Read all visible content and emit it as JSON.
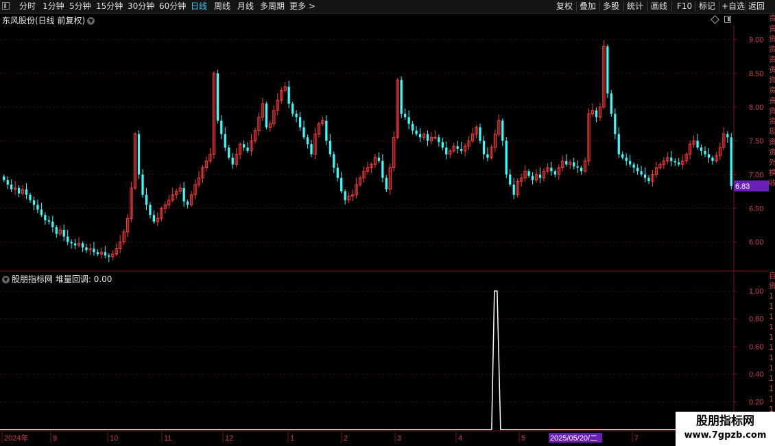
{
  "toolbar": {
    "left_items": [
      "分时",
      "1分钟",
      "5分钟",
      "15分钟",
      "30分钟",
      "60分钟",
      "日线",
      "周线",
      "月线",
      "多周期",
      "更多 >"
    ],
    "active_item": "日线",
    "right_items": [
      "复权",
      "叠加",
      "多股",
      "统计",
      "画线",
      "F10",
      "标记",
      "+自选",
      "返回"
    ]
  },
  "main_chart": {
    "title": "东风股份(日线 前复权)",
    "current_price_label": "6.83",
    "price_label_color": "#6a1fb8"
  },
  "indicator": {
    "title": "股朋指标网",
    "line_label": "堆量回调: 0.00"
  },
  "date_axis": {
    "labels": [
      "2024年",
      "9",
      "10",
      "11",
      "12",
      "1",
      "2",
      "3",
      "4",
      "5"
    ],
    "labels_after": [
      "7"
    ],
    "highlight_date": "2025/05/20/二"
  },
  "right_strip_chars": [
    "资",
    "资",
    "资",
    "资",
    "资",
    "资",
    "资",
    "资",
    "资",
    "资",
    "资",
    "现",
    "资",
    "资",
    "外",
    "换",
    "收",
    "",
    "",
    "",
    "",
    "",
    "",
    "",
    "",
    "自",
    "资",
    "1",
    "1",
    "1",
    "1",
    "1",
    "1",
    "1",
    "1",
    "1",
    "1",
    "1",
    "1"
  ],
  "watermark": {
    "name": "股朋指标网",
    "url": "www.7gpzb.com"
  },
  "colors": {
    "up": "#ff3b3b",
    "down": "#33ffff",
    "grid": "#4a0c0c",
    "axis_text": "#c94040",
    "indicator_line": "#ffffff"
  },
  "chart_data": [
    {
      "type": "candlestick",
      "title": "东风股份(日线 前复权)",
      "y_ticks": [
        6.0,
        6.5,
        7.0,
        7.5,
        8.0,
        8.5,
        9.0
      ],
      "ylim": [
        5.6,
        9.2
      ],
      "last_close": 6.83,
      "n_bars": 180,
      "closes": [
        6.92,
        6.85,
        6.78,
        6.8,
        6.72,
        6.78,
        6.7,
        6.62,
        6.55,
        6.48,
        6.4,
        6.32,
        6.3,
        6.22,
        6.12,
        6.18,
        6.08,
        6.0,
        5.98,
        5.95,
        5.98,
        5.92,
        5.88,
        5.9,
        5.85,
        5.82,
        5.85,
        5.8,
        5.78,
        5.82,
        5.9,
        6.0,
        6.15,
        6.35,
        6.8,
        7.6,
        7.0,
        6.7,
        6.55,
        6.4,
        6.3,
        6.35,
        6.5,
        6.55,
        6.62,
        6.7,
        6.75,
        6.8,
        6.6,
        6.55,
        6.7,
        6.85,
        6.95,
        7.1,
        7.2,
        7.3,
        8.5,
        7.8,
        7.6,
        7.4,
        7.25,
        7.15,
        7.3,
        7.45,
        7.4,
        7.35,
        7.5,
        7.65,
        7.85,
        8.05,
        7.7,
        7.75,
        7.95,
        8.1,
        8.25,
        8.3,
        8.05,
        7.9,
        7.85,
        7.7,
        7.55,
        7.45,
        7.3,
        7.6,
        7.75,
        7.8,
        7.5,
        7.3,
        7.1,
        6.95,
        6.75,
        6.62,
        6.68,
        6.7,
        6.85,
        6.95,
        7.05,
        7.1,
        7.15,
        7.25,
        7.2,
        6.95,
        6.78,
        7.1,
        7.55,
        8.4,
        7.9,
        7.85,
        7.75,
        7.65,
        7.6,
        7.55,
        7.6,
        7.5,
        7.55,
        7.55,
        7.48,
        7.4,
        7.3,
        7.35,
        7.42,
        7.38,
        7.35,
        7.42,
        7.5,
        7.6,
        7.7,
        7.5,
        7.3,
        7.25,
        7.4,
        7.6,
        7.8,
        7.5,
        7.0,
        6.85,
        6.7,
        6.9,
        6.95,
        7.05,
        6.98,
        6.92,
        7.0,
        6.95,
        7.05,
        7.1,
        7.05,
        7.0,
        7.1,
        7.2,
        7.15,
        7.18,
        7.12,
        7.1,
        7.05,
        7.2,
        7.9,
        7.95,
        7.85,
        8.0,
        8.9,
        8.2,
        7.9,
        7.6,
        7.3,
        7.25,
        7.2,
        7.15,
        7.1,
        7.05,
        7.0,
        6.95,
        6.9,
        7.0,
        7.1,
        7.15,
        7.2,
        7.25,
        7.2,
        7.18,
        7.15,
        7.2,
        7.3,
        7.45,
        7.5,
        7.4,
        7.35,
        7.3,
        7.25,
        7.2,
        7.28,
        7.4,
        7.6,
        7.55,
        6.83
      ]
    },
    {
      "type": "line",
      "title": "堆量回调",
      "y_ticks": [
        0.2,
        0.4,
        0.6,
        0.8,
        1.0
      ],
      "ylim": [
        0,
        1.05
      ],
      "spike_index": 131,
      "spike_value": 1.0,
      "last_value": 0.0
    }
  ]
}
